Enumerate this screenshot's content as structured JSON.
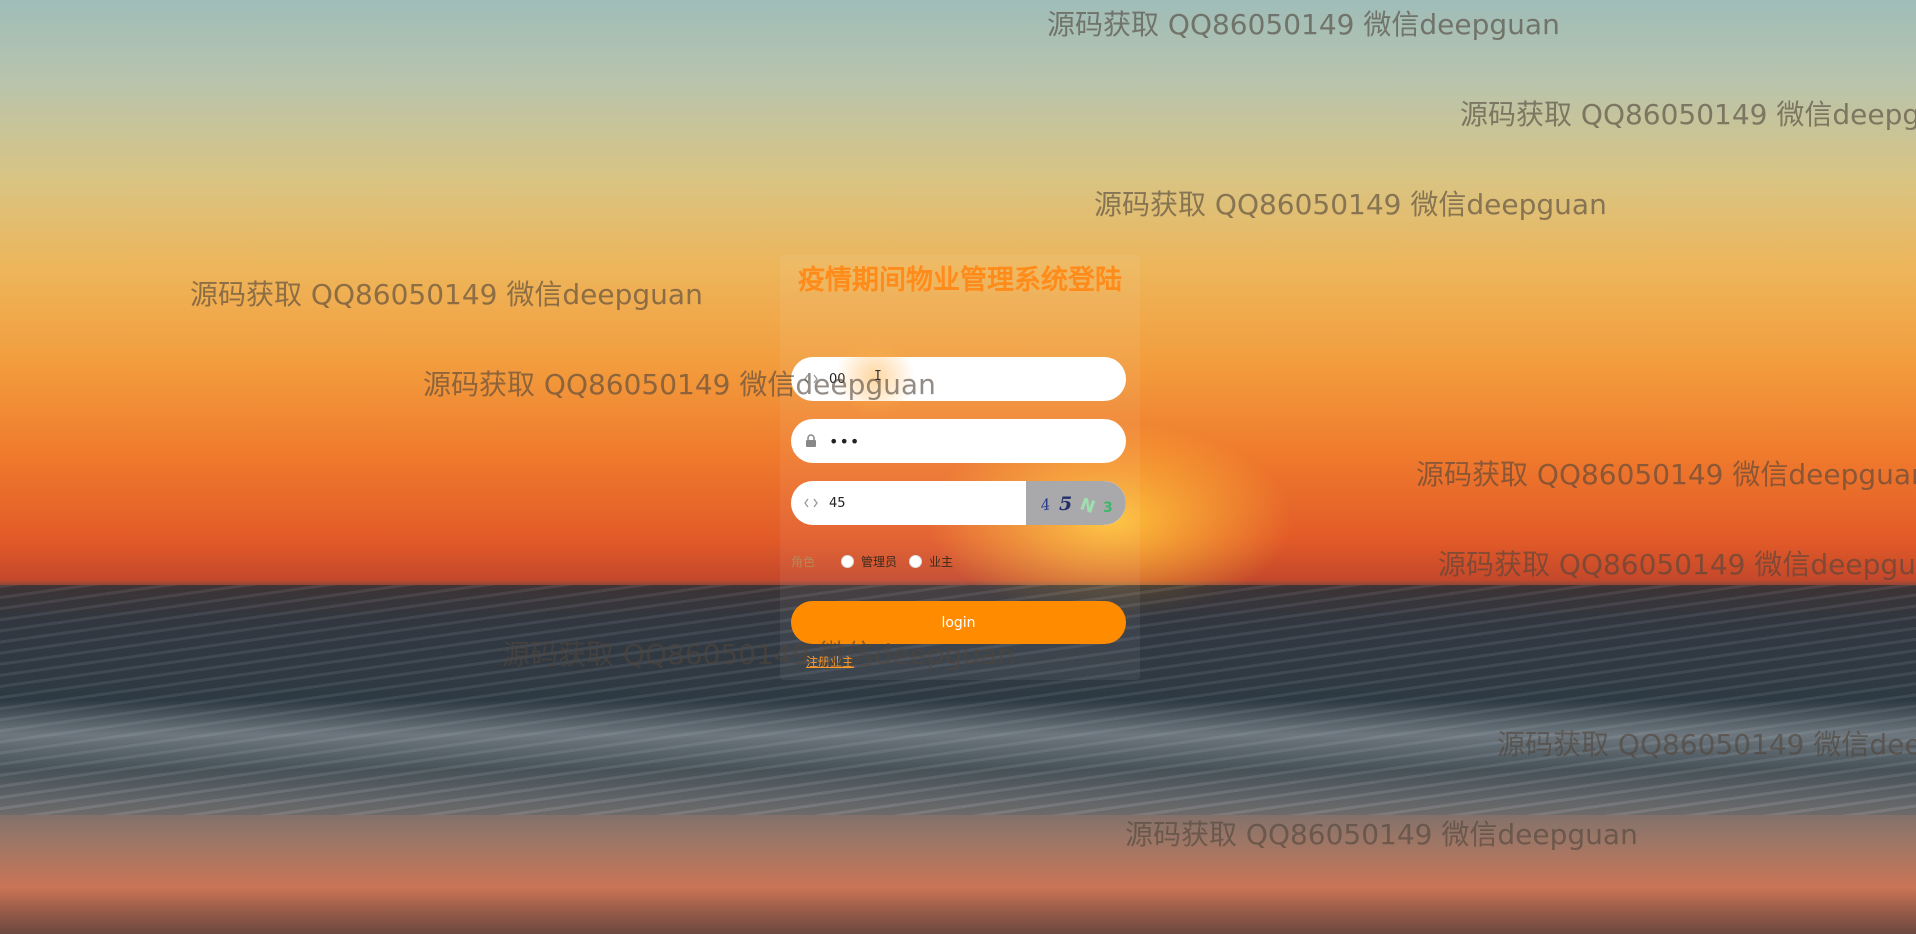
{
  "app": {
    "title": "疫情期间物业管理系统登陆"
  },
  "form": {
    "username_value": "00",
    "password_value": "•••",
    "captcha_value": "45",
    "captcha_text": "4 5 N 3",
    "role_label": "角色",
    "roles": [
      {
        "label": "管理员",
        "selected": false
      },
      {
        "label": "业主",
        "selected": false
      }
    ],
    "login_label": "login",
    "register_label": "注册业主"
  },
  "watermark": {
    "text": "源码获取 QQ86050149 微信deepguan"
  },
  "icons": {
    "username": "code-icon",
    "password": "lock-icon",
    "captcha": "code-icon"
  },
  "colors": {
    "accent": "#ff8c00",
    "title": "#ff8c1a",
    "captcha_bg": "#a9a9ab"
  }
}
